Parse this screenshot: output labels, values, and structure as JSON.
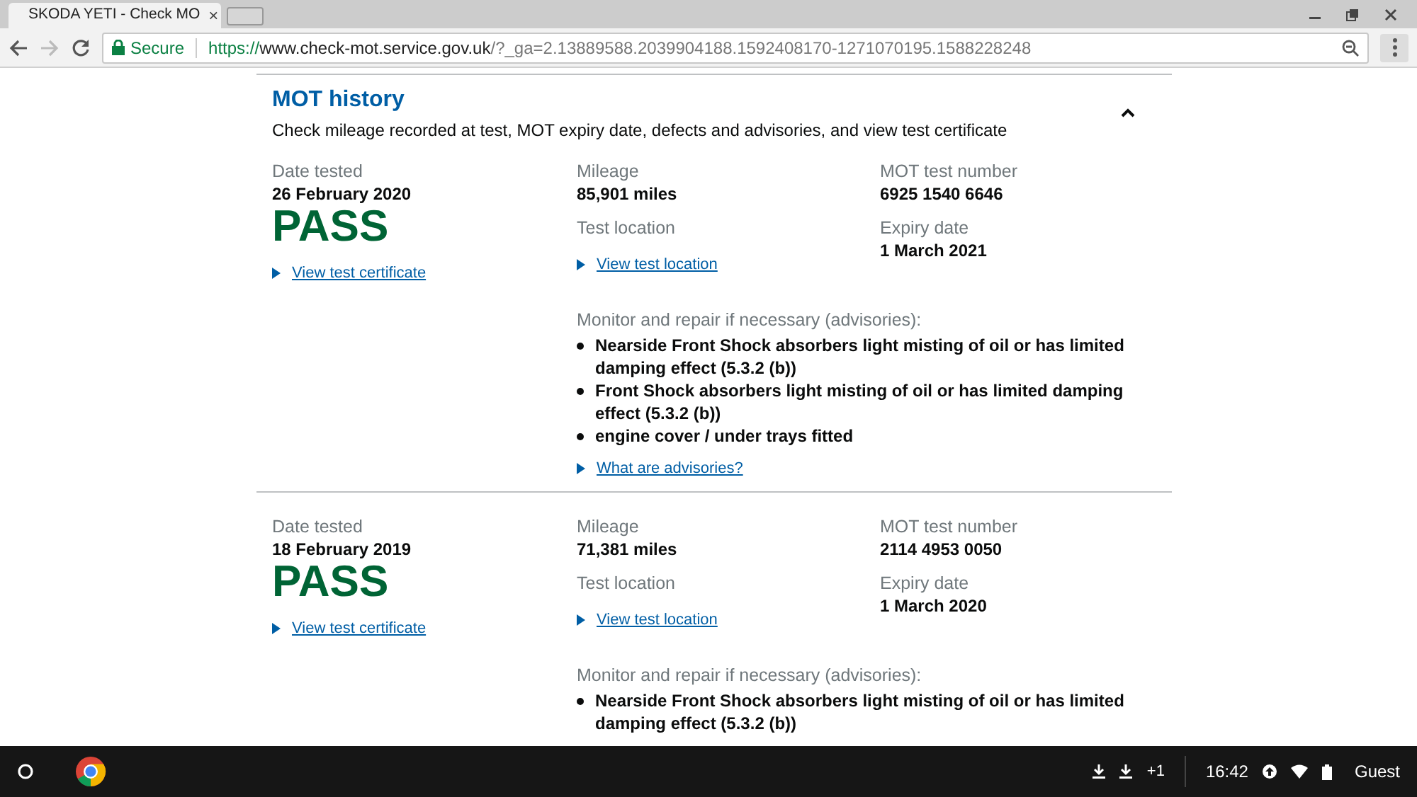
{
  "browser": {
    "tab": {
      "title": "SKODA YETI - Check MO",
      "close": "×"
    },
    "address": {
      "secure_label": "Secure",
      "scheme": "https://",
      "host": "www.check-mot.service.gov.uk",
      "path": "/?_ga=2.13889588.2039904188.1592408170-1271070195.1588228248"
    }
  },
  "section": {
    "title": "MOT history",
    "subtitle": "Check mileage recorded at test, MOT expiry date, defects and advisories, and view test certificate",
    "expanded": true
  },
  "tests": [
    {
      "date_label": "Date tested",
      "date": "26 February 2020",
      "result": "PASS",
      "certificate_link": "View test certificate",
      "mileage_label": "Mileage",
      "mileage": "85,901 miles",
      "location_label": "Test location",
      "location_link": "View test location",
      "test_number_label": "MOT test number",
      "test_number": "6925 1540 6646",
      "expiry_label": "Expiry date",
      "expiry": "1 March 2021",
      "advisories_label": "Monitor and repair if necessary (advisories):",
      "advisories": [
        "Nearside Front Shock absorbers light misting of oil or has limited damping effect (5.3.2 (b))",
        "Front Shock absorbers light misting of oil or has limited damping effect (5.3.2 (b))",
        "engine cover / under trays fitted"
      ],
      "advisories_link": "What are advisories?"
    },
    {
      "date_label": "Date tested",
      "date": "18 February 2019",
      "result": "PASS",
      "certificate_link": "View test certificate",
      "mileage_label": "Mileage",
      "mileage": "71,381 miles",
      "location_label": "Test location",
      "location_link": "View test location",
      "test_number_label": "MOT test number",
      "test_number": "2114 4953 0050",
      "expiry_label": "Expiry date",
      "expiry": "1 March 2020",
      "advisories_label": "Monitor and repair if necessary (advisories):",
      "advisories": [
        "Nearside Front Shock absorbers light misting of oil or has limited damping effect (5.3.2 (b))"
      ]
    }
  ],
  "shelf": {
    "downloads_extra": "+1",
    "time": "16:42",
    "user": "Guest"
  }
}
